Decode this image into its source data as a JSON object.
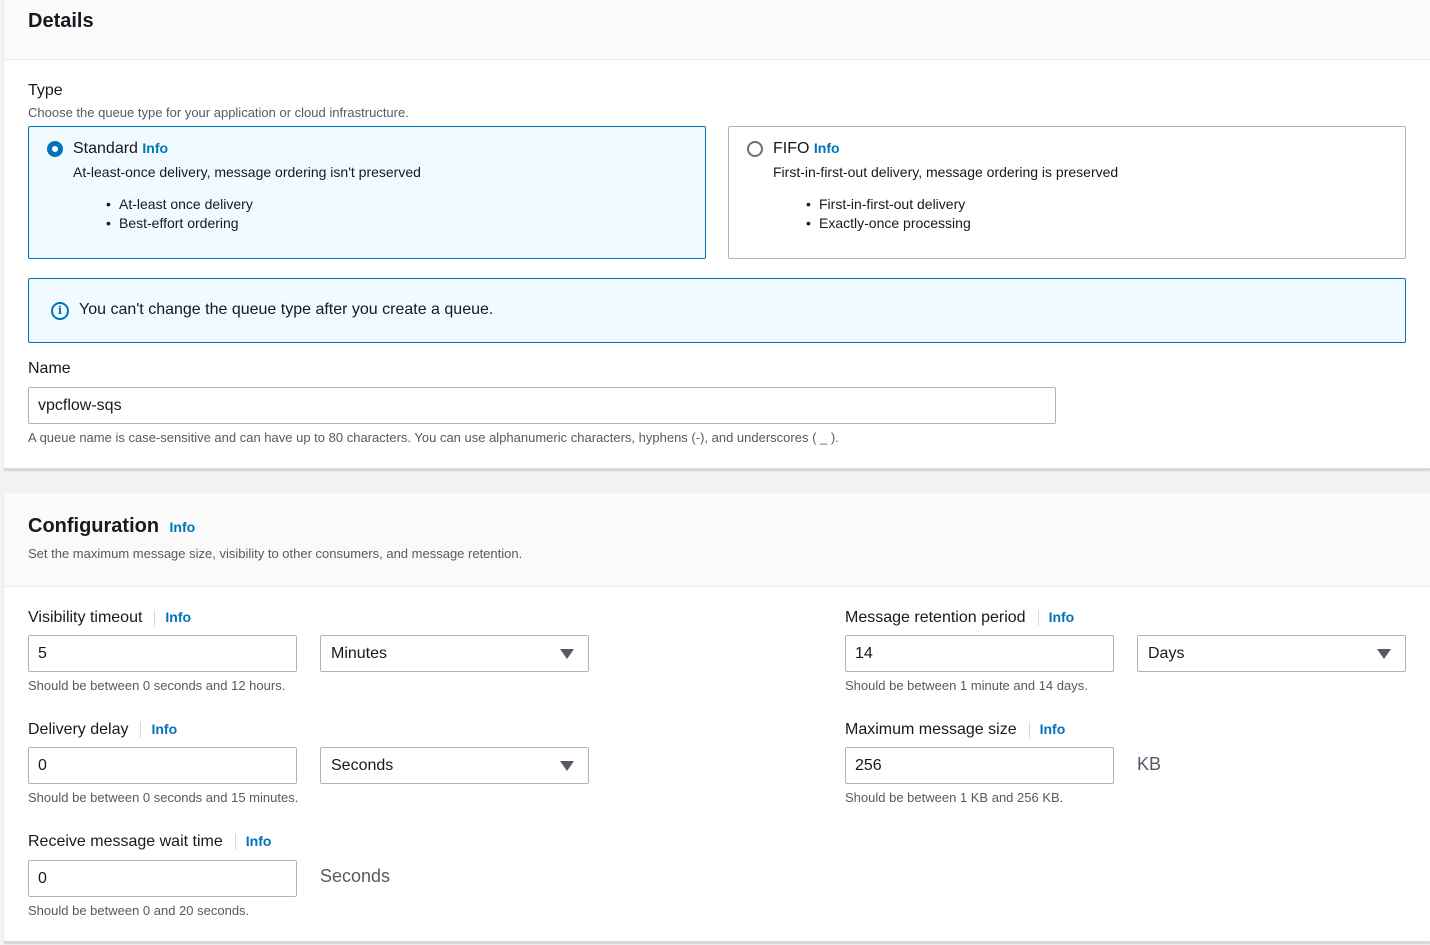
{
  "details": {
    "title": "Details",
    "type_label": "Type",
    "type_hint": "Choose the queue type for your application or cloud infrastructure.",
    "standard": {
      "title": "Standard",
      "info": "Info",
      "description": "At-least-once delivery, message ordering isn't preserved",
      "bullets": [
        "At-least once delivery",
        "Best-effort ordering"
      ],
      "selected": true
    },
    "fifo": {
      "title": "FIFO",
      "info": "Info",
      "description": "First-in-first-out delivery, message ordering is preserved",
      "bullets": [
        "First-in-first-out delivery",
        "Exactly-once processing"
      ],
      "selected": false
    },
    "alert_text": "You can't change the queue type after you create a queue.",
    "name_label": "Name",
    "name_value": "vpcflow-sqs",
    "name_hint": "A queue name is case-sensitive and can have up to 80 characters. You can use alphanumeric characters, hyphens (-), and underscores ( _ )."
  },
  "configuration": {
    "title": "Configuration",
    "info": "Info",
    "subtitle": "Set the maximum message size, visibility to other consumers, and message retention.",
    "visibility_timeout": {
      "label": "Visibility timeout",
      "info": "Info",
      "value": "5",
      "unit": "Minutes",
      "hint": "Should be between 0 seconds and 12 hours."
    },
    "delivery_delay": {
      "label": "Delivery delay",
      "info": "Info",
      "value": "0",
      "unit": "Seconds",
      "hint": "Should be between 0 seconds and 15 minutes."
    },
    "receive_wait": {
      "label": "Receive message wait time",
      "info": "Info",
      "value": "0",
      "unit": "Seconds",
      "hint": "Should be between 0 and 20 seconds."
    },
    "retention": {
      "label": "Message retention period",
      "info": "Info",
      "value": "14",
      "unit": "Days",
      "hint": "Should be between 1 minute and 14 days."
    },
    "max_size": {
      "label": "Maximum message size",
      "info": "Info",
      "value": "256",
      "unit": "KB",
      "hint": "Should be between 1 KB and 256 KB."
    }
  },
  "colors": {
    "accent": "#0073bb",
    "selected_bg": "#f1faff",
    "border": "#aab7b8"
  },
  "icons": {
    "alert": "info-circle-icon",
    "dropdown": "caret-down-icon"
  }
}
